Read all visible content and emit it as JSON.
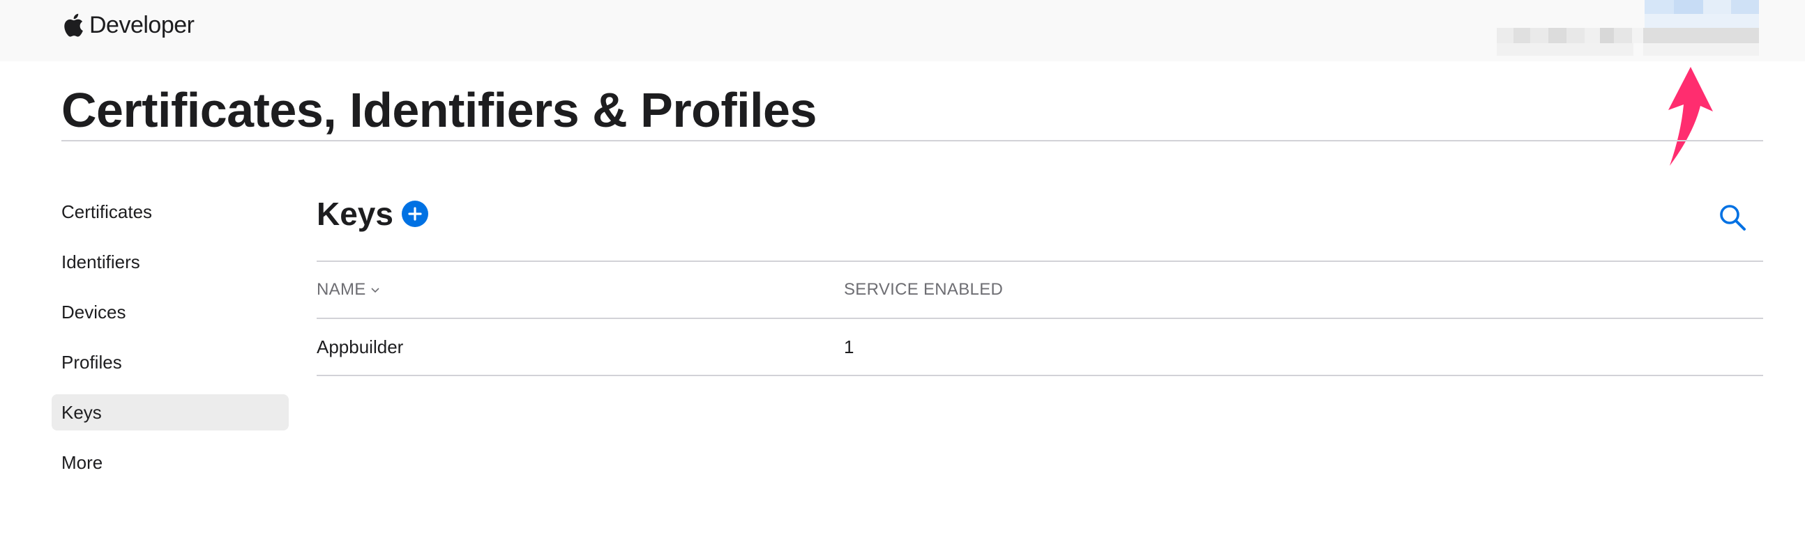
{
  "nav": {
    "brand": "Developer"
  },
  "page": {
    "title": "Certificates, Identifiers & Profiles"
  },
  "sidebar": {
    "items": [
      {
        "label": "Certificates"
      },
      {
        "label": "Identifiers"
      },
      {
        "label": "Devices"
      },
      {
        "label": "Profiles"
      },
      {
        "label": "Keys",
        "active": true
      },
      {
        "label": "More"
      }
    ]
  },
  "main": {
    "section_title": "Keys",
    "add_icon": "plus-circle-icon",
    "search_icon": "search-icon",
    "table": {
      "columns": [
        "NAME",
        "SERVICE ENABLED"
      ],
      "rows": [
        [
          "Appbuilder",
          "1"
        ]
      ]
    }
  },
  "colors": {
    "accent": "#0071e3",
    "arrow": "#ff2d6f",
    "nav_bg": "#f9f9f9",
    "active_bg": "#ececec"
  }
}
